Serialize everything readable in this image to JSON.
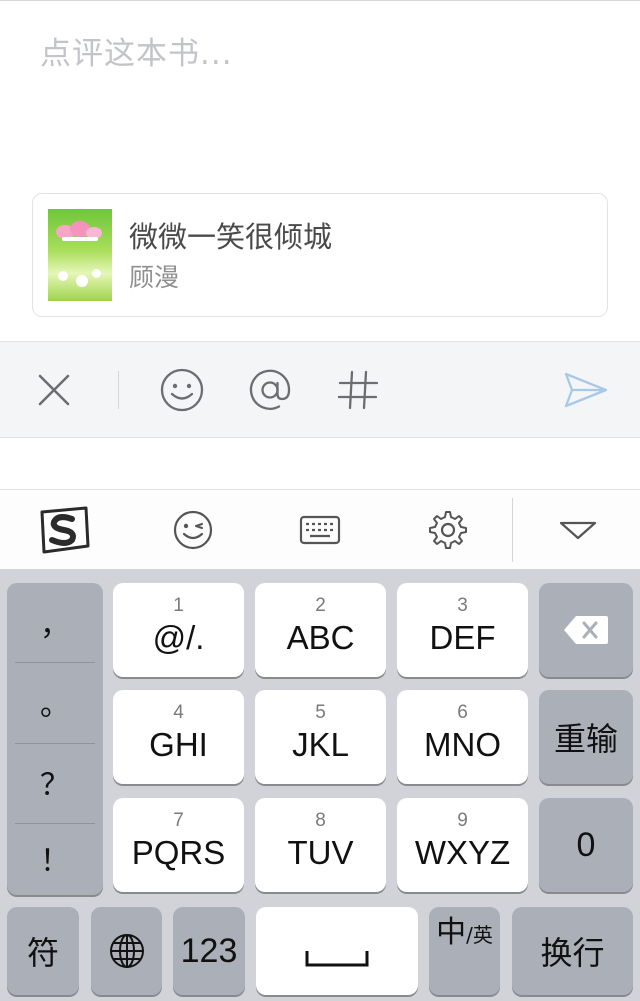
{
  "composer": {
    "placeholder": "点评这本书..."
  },
  "book": {
    "title": "微微一笑很倾城",
    "author": "顾漫",
    "cover_icon": "book-cover-image"
  },
  "toolbar": {
    "close_icon": "close-icon",
    "emoji_icon": "emoji-icon",
    "mention_icon": "at-mention-icon",
    "hashtag_icon": "hashtag-icon",
    "send_icon": "send-icon",
    "accent": "#a9c8e6"
  },
  "ime_bar": {
    "logo_icon": "sogou-logo-icon",
    "emoji_icon": "wink-emoji-icon",
    "keyboard_icon": "keyboard-icon",
    "settings_icon": "gear-icon",
    "collapse_icon": "chevron-down-icon"
  },
  "keyboard": {
    "punctuation": [
      "，",
      "。",
      "？",
      "！"
    ],
    "keys": [
      {
        "num": "1",
        "letters": "@/."
      },
      {
        "num": "2",
        "letters": "ABC"
      },
      {
        "num": "3",
        "letters": "DEF"
      },
      {
        "num": "4",
        "letters": "GHI"
      },
      {
        "num": "5",
        "letters": "JKL"
      },
      {
        "num": "6",
        "letters": "MNO"
      },
      {
        "num": "7",
        "letters": "PQRS"
      },
      {
        "num": "8",
        "letters": "TUV"
      },
      {
        "num": "9",
        "letters": "WXYZ"
      }
    ],
    "delete_icon": "backspace-icon",
    "reinput": "重输",
    "zero": "0",
    "symbols": "符",
    "globe_icon": "globe-icon",
    "numbers": "123",
    "space_icon": "space-bar-icon",
    "lang_main": "中",
    "lang_sub": "/英",
    "return": "换行"
  }
}
